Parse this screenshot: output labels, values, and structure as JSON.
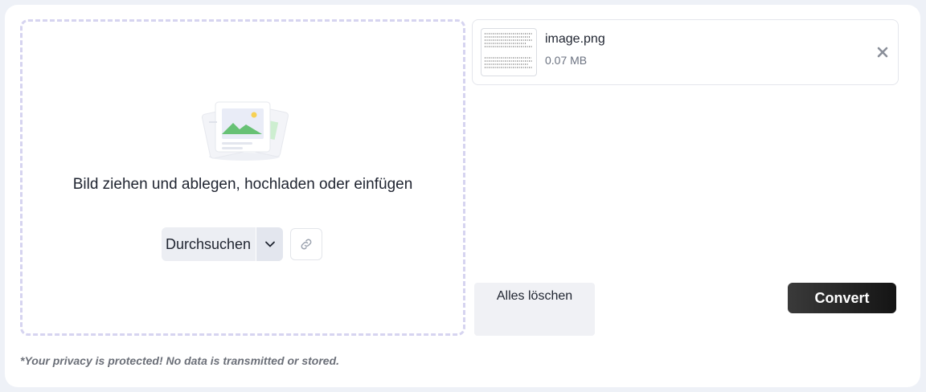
{
  "dropzone": {
    "text": "Bild ziehen und ablegen, hochladen oder einfügen",
    "browse_label": "Durchsuchen",
    "illustration_icon": "image-stack-icon",
    "caret_icon": "chevron-down-icon",
    "link_icon": "link-icon"
  },
  "files": [
    {
      "name": "image.png",
      "size": "0.07 MB",
      "remove_icon": "close-icon"
    }
  ],
  "actions": {
    "clear_all_label": "Alles löschen",
    "convert_label": "Convert"
  },
  "footer": {
    "privacy_note": "*Your privacy is protected! No data is transmitted or stored."
  },
  "colors": {
    "dropzone_border": "#d6d4f0",
    "convert_bg": "#1e1e1e",
    "page_bg": "#eef1f7"
  }
}
